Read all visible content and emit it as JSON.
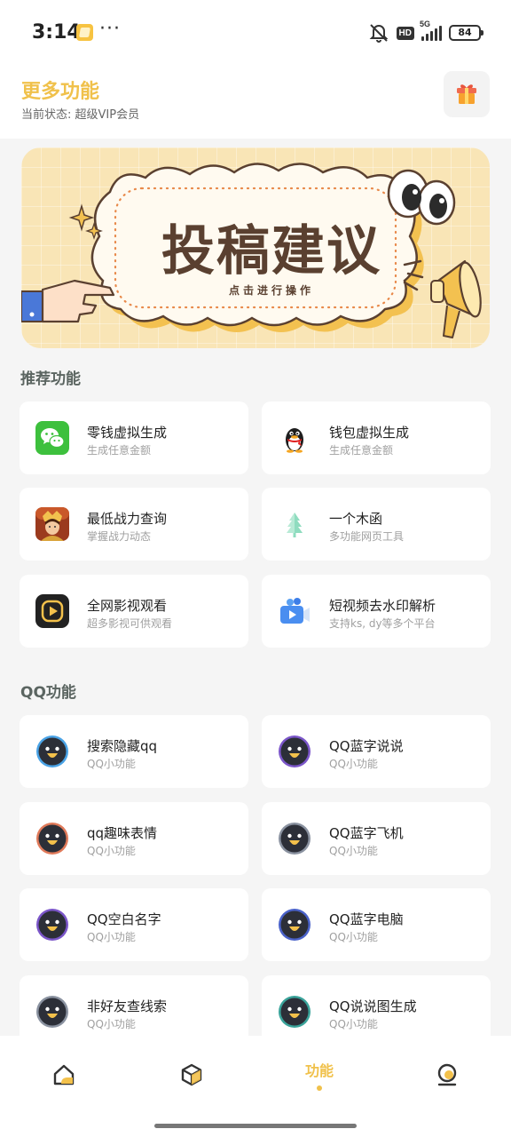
{
  "status_bar": {
    "time": "3:14",
    "more": "···",
    "hd": "HD",
    "network": "5G",
    "battery": "84"
  },
  "header": {
    "title": "更多功能",
    "subtitle": "当前状态: 超级VIP会员",
    "gift_icon": "gift-icon"
  },
  "banner": {
    "title": "投稿建议",
    "subtitle": "点击进行操作"
  },
  "sections": {
    "recommended": {
      "title": "推荐功能",
      "items": [
        {
          "name": "零钱虚拟生成",
          "desc": "生成任意金额",
          "icon": "wechat-icon"
        },
        {
          "name": "钱包虚拟生成",
          "desc": "生成任意金额",
          "icon": "qq-penguin-icon"
        },
        {
          "name": "最低战力查询",
          "desc": "掌握战力动态",
          "icon": "game-hero-icon"
        },
        {
          "name": "一个木函",
          "desc": "多功能网页工具",
          "icon": "tree-icon"
        },
        {
          "name": "全网影视观看",
          "desc": "超多影视可供观看",
          "icon": "video-play-icon"
        },
        {
          "name": "短视频去水印解析",
          "desc": "支持ks, dy等多个平台",
          "icon": "video-camera-icon"
        }
      ]
    },
    "qq": {
      "title": "QQ功能",
      "items": [
        {
          "name": "搜索隐藏qq",
          "desc": "QQ小功能",
          "ring": "#4aa3e6"
        },
        {
          "name": "QQ蓝字说说",
          "desc": "QQ小功能",
          "ring": "#7b56c9"
        },
        {
          "name": "qq趣味表情",
          "desc": "QQ小功能",
          "ring": "#e07a5a"
        },
        {
          "name": "QQ蓝字飞机",
          "desc": "QQ小功能",
          "ring": "#8a92a0"
        },
        {
          "name": "QQ空白名字",
          "desc": "QQ小功能",
          "ring": "#7b56c9"
        },
        {
          "name": "QQ蓝字电脑",
          "desc": "QQ小功能",
          "ring": "#4a62c9"
        },
        {
          "name": "非好友查线索",
          "desc": "QQ小功能",
          "ring": "#8a92a0"
        },
        {
          "name": "QQ说说图生成",
          "desc": "QQ小功能",
          "ring": "#3aa39a"
        }
      ]
    }
  },
  "bottom_nav": {
    "items": [
      {
        "label": "",
        "icon": "home-icon"
      },
      {
        "label": "",
        "icon": "cube-icon"
      },
      {
        "label": "功能",
        "icon": "",
        "active": true
      },
      {
        "label": "",
        "icon": "profile-icon"
      }
    ]
  },
  "colors": {
    "accent": "#f0c14b",
    "background": "#f5f5f5",
    "banner_bg": "#f9e5b6"
  }
}
